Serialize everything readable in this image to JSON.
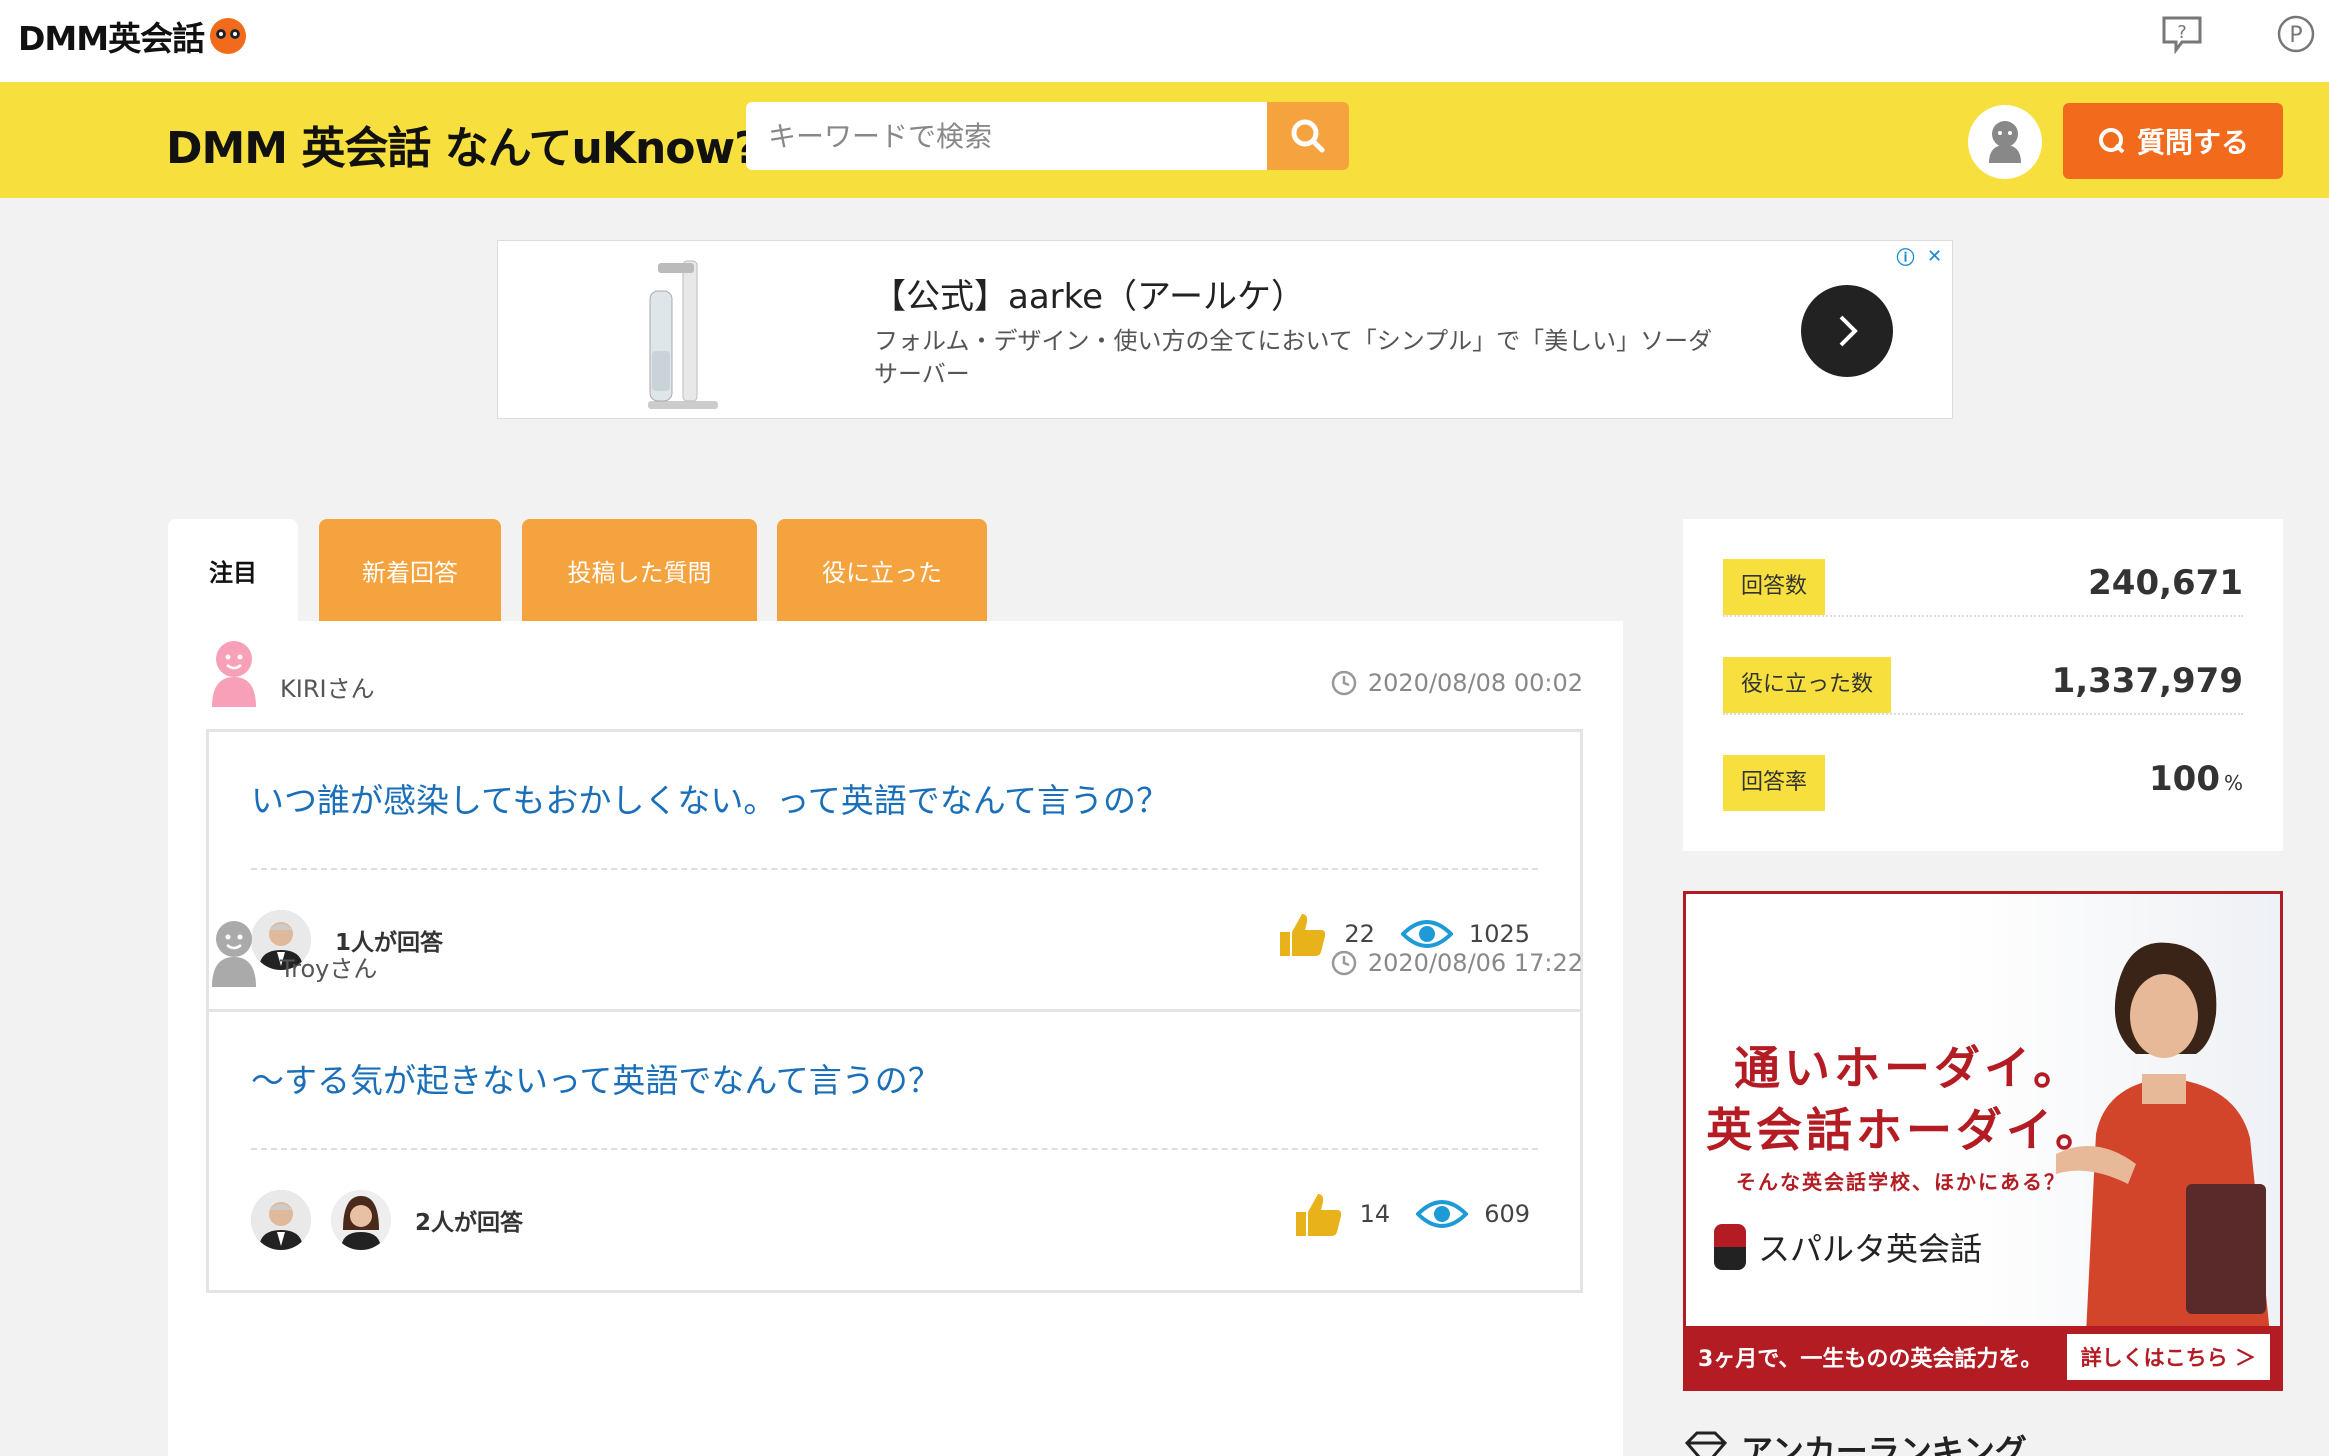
{
  "topbar": {
    "logo_text": "DMM英会話",
    "help_icon": "question-bubble-icon",
    "point_icon": "point-p-icon"
  },
  "header": {
    "site_title": "DMM 英会話 なんてuKnow?",
    "search_placeholder": "キーワードで検索",
    "ask_button": "質問する",
    "colors": {
      "header_bg": "#f7e03d",
      "accent_orange": "#f26b1d",
      "search_btn": "#f5a33f"
    }
  },
  "ad": {
    "title": "【公式】aarke（アールケ）",
    "description": "フォルム・デザイン・使い方の全てにおいて「シンプル」で「美しい」ソーダサーバー"
  },
  "tabs": [
    {
      "label": "注目",
      "active": true
    },
    {
      "label": "新着回答",
      "active": false
    },
    {
      "label": "投稿した質問",
      "active": false
    },
    {
      "label": "役に立った",
      "active": false
    }
  ],
  "posts": [
    {
      "user": "KIRIさん",
      "date": "2020/08/08 00:02",
      "title": "いつ誰が感染してもおかしくない。って英語でなんて言うの？",
      "answer_count": "1人が回答",
      "likes": "22",
      "views": "1025"
    },
    {
      "user": "Troyさん",
      "date": "2020/08/06 17:22",
      "title": "～する気が起きないって英語でなんて言うの？",
      "answer_count": "2人が回答",
      "likes": "14",
      "views": "609"
    }
  ],
  "side_stats": [
    {
      "label": "回答数",
      "value": "240,671",
      "unit": ""
    },
    {
      "label": "役に立った数",
      "value": "1,337,979",
      "unit": ""
    },
    {
      "label": "回答率",
      "value": "100",
      "unit": "%"
    }
  ],
  "side_ad": {
    "line1": "通いホーダイ。",
    "line2": "英会話ホーダイ。",
    "line3": "そんな英会話学校、ほかにある？",
    "brand": "スパルタ英会話",
    "bottom_text": "3ヶ月で、一生ものの英会話力を。",
    "bottom_button": "詳しくはこちら ＞"
  },
  "ranking": {
    "title": "アンカーランキング"
  }
}
